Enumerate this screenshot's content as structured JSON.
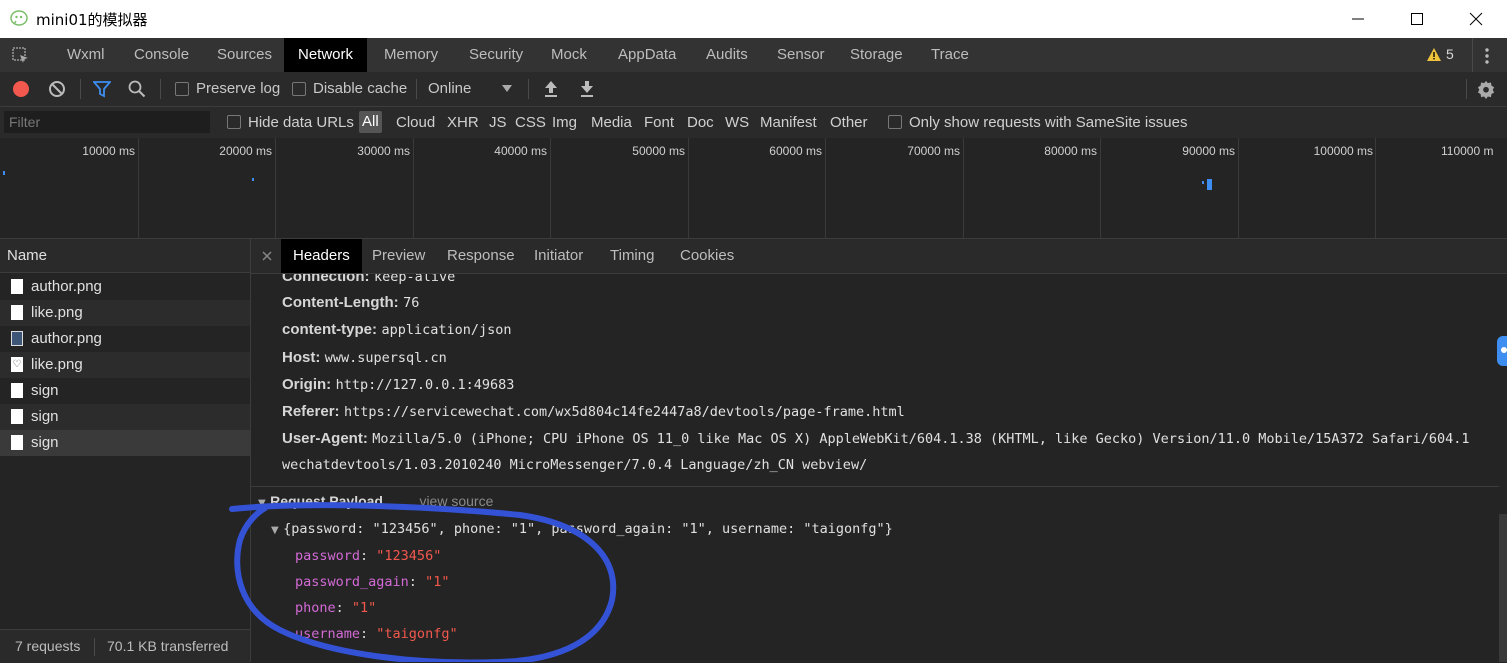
{
  "window": {
    "title": "mini01的模拟器",
    "min_glyph": "—",
    "max_glyph": "☐",
    "close_glyph": "✕"
  },
  "tabs": [
    "Wxml",
    "Console",
    "Sources",
    "Network",
    "Memory",
    "Security",
    "Mock",
    "AppData",
    "Audits",
    "Sensor",
    "Storage",
    "Trace"
  ],
  "active_tab": "Network",
  "warnings": {
    "count": "5"
  },
  "toolbar": {
    "preserve_log": "Preserve log",
    "disable_cache": "Disable cache",
    "throttle": "Online"
  },
  "filter": {
    "placeholder": "Filter",
    "hide_data_urls": "Hide data URLs",
    "types": [
      "All",
      "Cloud",
      "XHR",
      "JS",
      "CSS",
      "Img",
      "Media",
      "Font",
      "Doc",
      "WS",
      "Manifest",
      "Other"
    ],
    "selected_type": "All",
    "samesite": "Only show requests with SameSite issues"
  },
  "timeline": {
    "ticks": [
      "10000 ms",
      "20000 ms",
      "30000 ms",
      "40000 ms",
      "50000 ms",
      "60000 ms",
      "70000 ms",
      "80000 ms",
      "90000 ms",
      "100000 ms",
      "110000 m"
    ]
  },
  "requests": {
    "header": "Name",
    "items": [
      {
        "name": "author.png",
        "icon": "file-icon"
      },
      {
        "name": "like.png",
        "icon": "file-icon"
      },
      {
        "name": "author.png",
        "icon": "image-icon"
      },
      {
        "name": "like.png",
        "icon": "heart-icon"
      },
      {
        "name": "sign",
        "icon": "file-icon"
      },
      {
        "name": "sign",
        "icon": "file-icon"
      },
      {
        "name": "sign",
        "icon": "file-icon"
      }
    ],
    "status_count": "7 requests",
    "status_transferred": "70.1 KB transferred"
  },
  "detail": {
    "tabs": [
      "Headers",
      "Preview",
      "Response",
      "Initiator",
      "Timing",
      "Cookies"
    ],
    "active": "Headers",
    "headers": [
      {
        "key": "Connection:",
        "value": "keep-alive"
      },
      {
        "key": "Content-Length:",
        "value": "76"
      },
      {
        "key": "content-type:",
        "value": "application/json"
      },
      {
        "key": "Host:",
        "value": "www.supersql.cn"
      },
      {
        "key": "Origin:",
        "value": "http://127.0.0.1:49683"
      },
      {
        "key": "Referer:",
        "value": "https://servicewechat.com/wx5d804c14fe2447a8/devtools/page-frame.html"
      },
      {
        "key": "User-Agent:",
        "value": "Mozilla/5.0 (iPhone; CPU iPhone OS 11_0 like Mac OS X) AppleWebKit/604.1.38 (KHTML, like Gecko) Version/11.0 Mobile/15A372 Safari/604.1"
      }
    ],
    "ua_continuation": "wechatdevtools/1.03.2010240 MicroMessenger/7.0.4 Language/zh_CN webview/",
    "payload_title": "Request Payload",
    "view_source": "view source",
    "payload_summary": "{password: \"123456\", phone: \"1\", password_again: \"1\", username: \"taigonfg\"}",
    "payload_fields": [
      {
        "key": "password",
        "value": "\"123456\""
      },
      {
        "key": "password_again",
        "value": "\"1\""
      },
      {
        "key": "phone",
        "value": "\"1\""
      },
      {
        "key": "username",
        "value": "\"taigonfg\""
      }
    ]
  },
  "colors": {
    "annotation": "#3452d6",
    "record": "#f2584d",
    "accent": "#3d8ef0",
    "payload_key": "#d36ad6",
    "payload_value": "#f2584d"
  }
}
